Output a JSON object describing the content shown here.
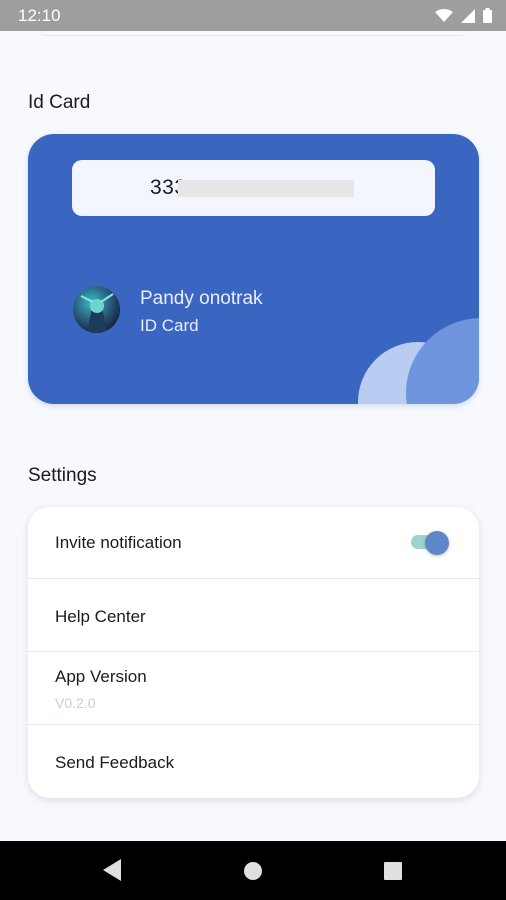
{
  "status_bar": {
    "time": "12:10"
  },
  "id_card_section": {
    "title": "Id Card",
    "card_number": "333",
    "holder_name": "Pandy onotrak",
    "card_type": "ID Card",
    "card_color": "#3a66c2"
  },
  "settings_section": {
    "title": "Settings",
    "items": [
      {
        "label": "Invite notification",
        "toggle_on": true
      },
      {
        "label": "Help Center"
      },
      {
        "label": "App Version",
        "value": "V0.2.0"
      },
      {
        "label": "Send Feedback"
      }
    ]
  },
  "nav_bar": {
    "back": "back-icon",
    "home": "home-icon",
    "recents": "recents-icon"
  }
}
